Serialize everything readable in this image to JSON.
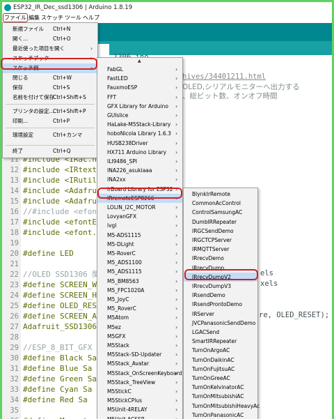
{
  "window": {
    "title": "ESP32_IR_Dec_ssd1306 | Arduino 1.8.19"
  },
  "menubar": [
    "ファイル",
    "編集",
    "スケッチ",
    "ツール",
    "ヘルプ"
  ],
  "file_menu": [
    {
      "label": "新規ファイル",
      "shortcut": "Ctrl+N"
    },
    {
      "label": "開く...",
      "shortcut": "Ctrl+O"
    },
    {
      "label": "最近使った項目を開く",
      "submenu": true
    },
    {
      "label": "スケッチブック",
      "submenu": true
    },
    {
      "label": "スケッチ例",
      "submenu": true,
      "highlight": true
    },
    {
      "label": "閉じる",
      "shortcut": "Ctrl+W"
    },
    {
      "label": "保存",
      "shortcut": "Ctrl+S"
    },
    {
      "label": "名前を付けて保存",
      "shortcut": "Ctrl+Shift+S"
    },
    {
      "label": "プリンタの設定...",
      "shortcut": "Ctrl+Shift+P"
    },
    {
      "label": "印刷...",
      "shortcut": "Ctrl+P"
    },
    {
      "label": "環境設定",
      "shortcut": "Ctrl+カンマ"
    },
    {
      "label": "終了",
      "shortcut": "Ctrl+Q"
    }
  ],
  "examples_menu": [
    {
      "label": "FabGL",
      "submenu": true
    },
    {
      "label": "FastLED",
      "submenu": true
    },
    {
      "label": "FauxmoESP",
      "submenu": true
    },
    {
      "label": "FFT",
      "submenu": true
    },
    {
      "label": "GFX Library for Arduino",
      "submenu": true
    },
    {
      "label": "GUIslice",
      "submenu": true
    },
    {
      "label": "HaLake-M5Stack-Library",
      "submenu": true
    },
    {
      "label": "hoboNicola Library 1.6.3",
      "submenu": true
    },
    {
      "label": "HUSB238Driver",
      "submenu": true
    },
    {
      "label": "HX711 Arduino Library",
      "submenu": true
    },
    {
      "label": "ILI9486_SPI",
      "submenu": true
    },
    {
      "label": "INA226_asukiaaa",
      "submenu": true
    },
    {
      "label": "INA2xx",
      "submenu": true
    },
    {
      "label": "irBoard Library for ESP32",
      "submenu": true
    },
    {
      "label": "IRremoteESP8266",
      "submenu": true,
      "highlight": true
    },
    {
      "label": "LOLIN_I2C_MOTOR",
      "submenu": true
    },
    {
      "label": "LovyanGFX",
      "submenu": true
    },
    {
      "label": "lvgl",
      "submenu": true
    },
    {
      "label": "M5-ADS1115",
      "submenu": true
    },
    {
      "label": "M5-DLight",
      "submenu": true
    },
    {
      "label": "M5-RoverC",
      "submenu": true
    },
    {
      "label": "M5_ADS1100",
      "submenu": true
    },
    {
      "label": "M5_ADS1115",
      "submenu": true
    },
    {
      "label": "M5_BM8563",
      "submenu": true
    },
    {
      "label": "M5_FPC1020A",
      "submenu": true
    },
    {
      "label": "M5_JoyC",
      "submenu": true
    },
    {
      "label": "M5_RoverC",
      "submenu": true
    },
    {
      "label": "M5Atom",
      "submenu": true
    },
    {
      "label": "M5ez",
      "submenu": true
    },
    {
      "label": "M5GFX",
      "submenu": true
    },
    {
      "label": "M5Stack",
      "submenu": true
    },
    {
      "label": "M5Stack-SD-Updater",
      "submenu": true
    },
    {
      "label": "M5Stack_Avatar",
      "submenu": true
    },
    {
      "label": "M5Stack_OnScreenKeyboard",
      "submenu": true
    },
    {
      "label": "M5Stack_TreeView",
      "submenu": true
    },
    {
      "label": "M5StickC",
      "submenu": true
    },
    {
      "label": "M5StickCPlus",
      "submenu": true
    },
    {
      "label": "M5Unit-4RELAY",
      "submenu": true
    },
    {
      "label": "M5Unit-ACSSR",
      "submenu": true
    },
    {
      "label": "M5Unit-DDS",
      "submenu": true
    }
  ],
  "ir_menu": [
    {
      "label": "BlynkIrRemote"
    },
    {
      "label": "CommonAcControl"
    },
    {
      "label": "ControlSamsungAC"
    },
    {
      "label": "DumbIRRepeater"
    },
    {
      "label": "IRGCSendDemo"
    },
    {
      "label": "IRGCTCPServer"
    },
    {
      "label": "IRMQTTServer"
    },
    {
      "label": "IRrecvDemo"
    },
    {
      "label": "IRrecvDump"
    },
    {
      "label": "IRrecvDumpV2",
      "highlight": true
    },
    {
      "label": "IRrecvDumpV3"
    },
    {
      "label": "IRsendDemo"
    },
    {
      "label": "IRsendProntoDemo"
    },
    {
      "label": "IRServer"
    },
    {
      "label": "JVCPanasonicSendDemo"
    },
    {
      "label": "LGACSend"
    },
    {
      "label": "SmartIRRepeater"
    },
    {
      "label": "TurnOnArgoAC"
    },
    {
      "label": "TurnOnDaikinAC"
    },
    {
      "label": "TurnOnFujitsuAC"
    },
    {
      "label": "TurnOnGreeAC"
    },
    {
      "label": "TurnOnKelvinatorAC"
    },
    {
      "label": "TurnOnMitsubishiAC"
    },
    {
      "label": "TurnOnMitsubishiHeavyAc"
    },
    {
      "label": "TurnOnPanasonicAC"
    }
  ],
  "editor": {
    "partial": {
      "tab_name": "1306.ino",
      "link": "hives/34401211.html",
      "comment1": "OLED,シリアルモニターへ出力する",
      "comment2": "、総ビット数、オンオフ時間",
      "line10": "#include <IRremot",
      "line11": "#include <IRac.h>",
      "line12": "#include <IRtext.h",
      "line13": "#include <IRutils",
      "line14": "#include <Adafrui",
      "line15": "#include <Adafrui",
      "line16": "//#include <efont",
      "line17": "#include <efontEna",
      "line18": "#include <efont.h",
      "line20": "#define LED",
      "line22": "//OLED SSD1306 関連",
      "line23": "#define SCREEN_WI",
      "line24": "#define SCREEN_HE",
      "line25": "#define OLED_RESE",
      "line26": "#define SCREEN_AD",
      "line27": "Adafruit_SSD1306 d",
      "line29": "//ESP_8_BIT_GFX &",
      "line30": "#define Black   Sa",
      "line31": "#define Blue    Sa",
      "line32": "#define Green   Sa",
      "line33": "#define Cyan    Sa",
      "line34": "#define Red     Sa",
      "line36": "#define Magenta Sa",
      "r24": "els",
      "r25": "xels",
      "r27": "re, OLED_RESET);"
    }
  }
}
